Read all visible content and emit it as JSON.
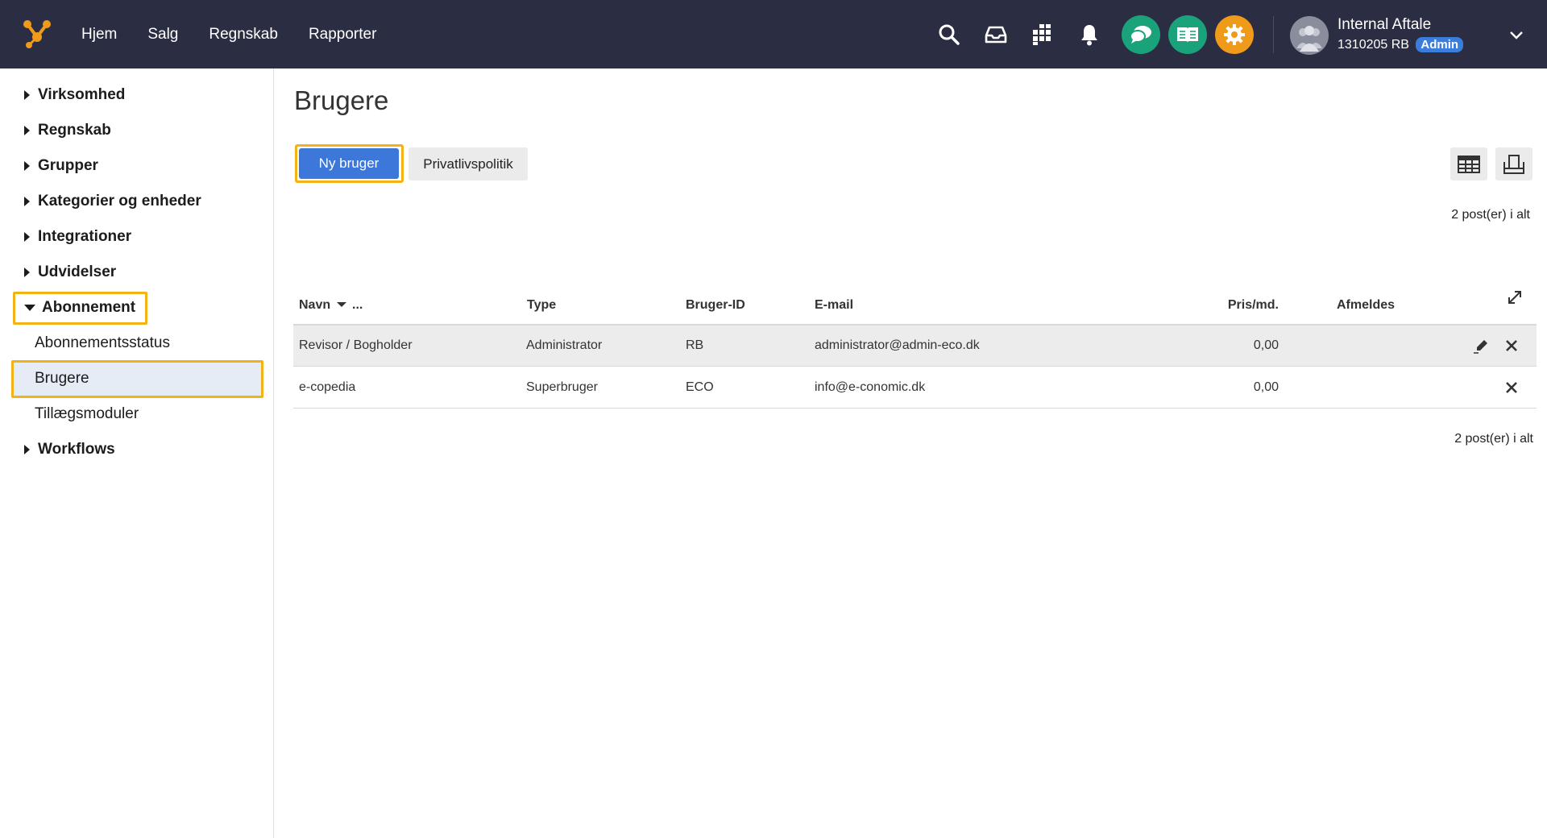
{
  "topbar": {
    "nav": [
      "Hjem",
      "Salg",
      "Regnskab",
      "Rapporter"
    ],
    "icons": [
      "search-icon",
      "inbox-icon",
      "apps-icon",
      "bell-icon",
      "chat-icon",
      "book-icon",
      "gear-icon"
    ],
    "colors": {
      "bar": "#2b2d42",
      "chat": "#1aa37a",
      "book": "#1aa37a",
      "gear": "#f09a1a",
      "accent": "#3b7ddd"
    },
    "user": {
      "name": "Internal Aftale",
      "id": "1310205 RB",
      "badge": "Admin"
    }
  },
  "sidebar": {
    "groups": [
      {
        "label": "Virksomhed"
      },
      {
        "label": "Regnskab"
      },
      {
        "label": "Grupper"
      },
      {
        "label": "Kategorier og enheder"
      },
      {
        "label": "Integrationer"
      },
      {
        "label": "Udvidelser"
      },
      {
        "label": "Abonnement",
        "expanded": true
      },
      {
        "label": "Workflows"
      }
    ],
    "sub_items": [
      "Abonnementsstatus",
      "Brugere",
      "Tillægsmoduler"
    ],
    "selected": "Brugere"
  },
  "main": {
    "title": "Brugere",
    "new_button": "Ny bruger",
    "privacy_button": "Privatlivspolitik",
    "count_top": "2 post(er) i alt",
    "count_bottom": "2 post(er) i alt",
    "columns": {
      "name": "Navn",
      "more": "...",
      "type": "Type",
      "user_id": "Bruger-ID",
      "email": "E-mail",
      "price": "Pris/md.",
      "unsubscribe": "Afmeldes"
    },
    "rows": [
      {
        "name": "Revisor / Bogholder",
        "type": "Administrator",
        "user_id": "RB",
        "email": "administrator@admin-eco.dk",
        "price": "0,00"
      },
      {
        "name": "e-copedia",
        "type": "Superbruger",
        "user_id": "ECO",
        "email": "info@e-conomic.dk",
        "price": "0,00"
      }
    ]
  }
}
